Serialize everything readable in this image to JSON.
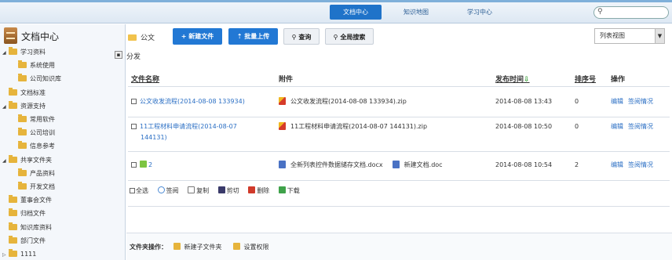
{
  "topnav": {
    "items": [
      {
        "label": "文档中心",
        "active": true
      },
      {
        "label": "知识地图",
        "active": false
      },
      {
        "label": "学习中心",
        "active": false
      }
    ],
    "search_placeholder": ""
  },
  "sidebar": {
    "title": "文档中心",
    "tree": [
      {
        "label": "学习资料",
        "level": 0,
        "toggle": "◢"
      },
      {
        "label": "系统使用",
        "level": 1,
        "toggle": ""
      },
      {
        "label": "公司知识库",
        "level": 1,
        "toggle": ""
      },
      {
        "label": "文档标准",
        "level": 0,
        "toggle": ""
      },
      {
        "label": "资源支持",
        "level": 0,
        "toggle": "◢"
      },
      {
        "label": "常用软件",
        "level": 1,
        "toggle": ""
      },
      {
        "label": "公司培训",
        "level": 1,
        "toggle": ""
      },
      {
        "label": "信息参考",
        "level": 1,
        "toggle": ""
      },
      {
        "label": "共享文件夹",
        "level": 0,
        "toggle": "◢"
      },
      {
        "label": "产品资料",
        "level": 1,
        "toggle": ""
      },
      {
        "label": "开发文档",
        "level": 1,
        "toggle": ""
      },
      {
        "label": "董事会文件",
        "level": 0,
        "toggle": ""
      },
      {
        "label": "归档文件",
        "level": 0,
        "toggle": ""
      },
      {
        "label": "知识库资料",
        "level": 0,
        "toggle": ""
      },
      {
        "label": "部门文件",
        "level": 0,
        "toggle": ""
      },
      {
        "label": "1111",
        "level": 0,
        "toggle": "▷"
      }
    ]
  },
  "main": {
    "breadcrumb": "公文",
    "subtitle": "分发",
    "buttons": {
      "new_file": "+ 新建文件",
      "batch_upload": "⇡ 批量上传",
      "query": "查询",
      "fulltext_search": "全局搜索"
    },
    "view_select": "列表视图",
    "headers": {
      "name": "文件名称",
      "attachment": "附件",
      "publish_time": "发布时间",
      "order": "排序号",
      "action": "操作"
    },
    "rows": [
      {
        "name": "公文收发流程(2014-08-08 133934)",
        "name_line2": "",
        "attachments": [
          {
            "name": "公文收发流程(2014-08-08 133934).zip",
            "type": "zip"
          }
        ],
        "time": "2014-08-08 13:43",
        "order": "0",
        "act_edit": "编辑",
        "act_status": "签阅情况"
      },
      {
        "name": "11工程材料申请流程(2014-08-07",
        "name_line2": "144131)",
        "attachments": [
          {
            "name": "11工程材料申请流程(2014-08-07 144131).zip",
            "type": "zip"
          }
        ],
        "time": "2014-08-08 10:50",
        "order": "0",
        "act_edit": "编辑",
        "act_status": "签阅情况"
      },
      {
        "name": "2",
        "name_line2": "",
        "attachments": [
          {
            "name": "全新列表控件数据储存文档.docx",
            "type": "doc"
          },
          {
            "name": "新建文档.doc",
            "type": "doc"
          }
        ],
        "time": "2014-08-08 10:54",
        "order": "2",
        "act_edit": "编辑",
        "act_status": "签阅情况"
      }
    ],
    "bulk_actions": {
      "select_all": "全选",
      "sign": "签阅",
      "copy": "复制",
      "cut": "剪切",
      "delete": "删除",
      "download": "下载"
    },
    "folder_ops": {
      "label": "文件夹操作：",
      "new_subfolder": "新建子文件夹",
      "set_permission": "设置权限"
    }
  }
}
